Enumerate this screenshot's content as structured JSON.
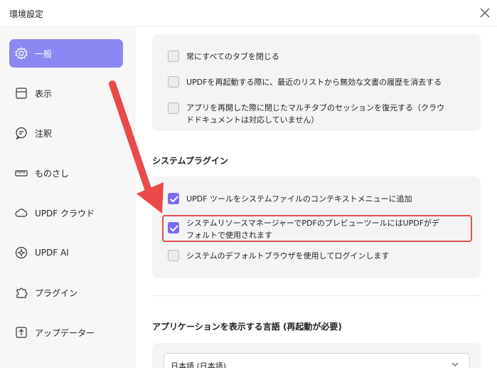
{
  "window": {
    "title": "環境設定"
  },
  "sidebar": {
    "items": [
      {
        "label": "一般",
        "icon": "gear-icon",
        "active": true
      },
      {
        "label": "表示",
        "icon": "display-icon"
      },
      {
        "label": "注釈",
        "icon": "comment-icon"
      },
      {
        "label": "ものさし",
        "icon": "ruler-icon"
      },
      {
        "label": "UPDF クラウド",
        "icon": "cloud-icon"
      },
      {
        "label": "UPDF AI",
        "icon": "ai-icon"
      },
      {
        "label": "プラグイン",
        "icon": "plugin-icon"
      },
      {
        "label": "アップデーター",
        "icon": "update-icon"
      }
    ]
  },
  "tabs_section": {
    "options": [
      {
        "label": "常にすべてのタブを閉じる",
        "checked": false
      },
      {
        "label": "UPDFを再起動する際に、最近のリストから無効な文書の履歴を消去する",
        "checked": false
      },
      {
        "label_line1": "アプリを再開した際に閉じたマルチタブのセッションを復元する（クラウ",
        "label_line2": "ドドキュメントは対応していません）",
        "checked": false
      }
    ]
  },
  "plugins_section": {
    "title": "システムプラグイン",
    "options": [
      {
        "label": "UPDF ツールをシステムファイルのコンテキストメニューに追加",
        "checked": true
      },
      {
        "label_line1": "システムリソースマネージャーでPDFのプレビューツールにはUPDFがデ",
        "label_line2": "フォルトで使用されます",
        "checked": true
      },
      {
        "label": "システムのデフォルトブラウザを使用してログインします",
        "checked": false
      }
    ]
  },
  "language_section": {
    "title": "アプリケーションを表示する言語 (再起動が必要)",
    "selected": "日本語 (日本語)"
  },
  "colors": {
    "accent": "#7b6bf0",
    "active_nav": "#8b88f4",
    "annotation": "#e05151"
  }
}
